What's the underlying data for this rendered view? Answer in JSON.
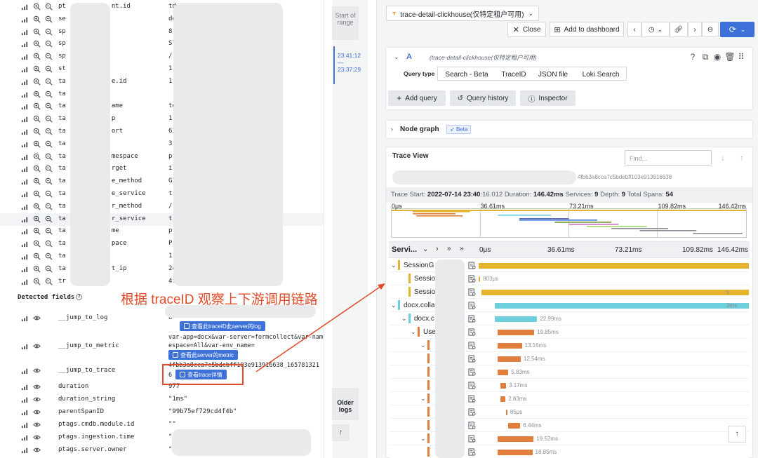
{
  "left_panel": {
    "fields": [
      {
        "k": "pt            nt.id",
        "v": "td"
      },
      {
        "k": "se",
        "v": "de"
      },
      {
        "k": "sp",
        "v": "8("
      },
      {
        "k": "sp",
        "v": "Sl"
      },
      {
        "k": "sp",
        "v": "/                     GET"
      },
      {
        "k": "st",
        "v": "1"
      },
      {
        "k": "ta            e.id",
        "v": "1"
      },
      {
        "k": "ta",
        "v": ""
      },
      {
        "k": "ta            ame",
        "v": "to                    -4"
      },
      {
        "k": "ta            p",
        "v": "1("
      },
      {
        "k": "ta            ort",
        "v": "63"
      },
      {
        "k": "ta",
        "v": "3("
      },
      {
        "k": "ta            mespace",
        "v": "p"
      },
      {
        "k": "ta            rget",
        "v": "i("
      },
      {
        "k": "ta            e_method",
        "v": "GI"
      },
      {
        "k": "ta            e_service",
        "v": "t"
      },
      {
        "k": "ta            r_method",
        "v": "/("
      },
      {
        "k": "ta            r_service",
        "v": "t                     Service"
      },
      {
        "k": "ta            me",
        "v": "p"
      },
      {
        "k": "ta            pace",
        "v": "P"
      },
      {
        "k": "ta",
        "v": "1-"
      },
      {
        "k": "ta            t_ip",
        "v": "24                    :1:a1df"
      },
      {
        "k": "tr",
        "v": "4f"
      }
    ],
    "detected_title": "Detected fields",
    "detected": [
      {
        "k": "__jump_to_log",
        "v": "8'"
      },
      {
        "k": "__jump_to_metric",
        "v": ""
      },
      {
        "k": "__jump_to_trace",
        "v": ""
      },
      {
        "k": "duration",
        "v": "977"
      },
      {
        "k": "duration_string",
        "v": "\"1ms\""
      },
      {
        "k": "parentSpanID",
        "v": "\"99b75ef729cd4f4b\""
      },
      {
        "k": "ptags.cmdb.module.id",
        "v": "\"\""
      },
      {
        "k": "ptags.ingestion.time",
        "v": "\""
      },
      {
        "k": "ptags.server.owner",
        "v": "\""
      }
    ],
    "metric_lines": [
      "var-app=docx&var-server=formcollect&var-nam",
      "espace=All&var-env_name="
    ],
    "trace_lines": [
      "4fbb3a8cca7c5bdebff103e913916638_165781321",
      "6"
    ],
    "log_button": "查看此traceID此server的log",
    "metric_button": "查看此server的metric",
    "trace_button": "查看trace详情",
    "annotation": "根据 traceID 观察上下游调用链路"
  },
  "mid_strip": {
    "start_range": "Start of range",
    "range_from": "23:41:12",
    "range_sep": "—",
    "range_to": "23:37:29",
    "older_logs": "Older logs",
    "up_label": "↑"
  },
  "right_panel": {
    "datasource": "trace-detail-clickhouse(仅特定租户可用)",
    "close": "Close",
    "add_dashboard": "Add to dashboard",
    "query_letter": "A",
    "query_ds": "(trace-detail-clickhouse(仅特定租户可用)",
    "query_type_label": "Query type",
    "query_tabs": [
      "Search - Beta",
      "TraceID",
      "JSON file",
      "Loki Search"
    ],
    "add_query": "Add query",
    "query_history": "Query history",
    "inspector": "Inspector",
    "node_graph": "Node graph",
    "beta": "Beta",
    "trace_view": "Trace View",
    "find_placeholder": "Find...",
    "trace_id": "4fbb3a8cca7c5bdebff103e913916638",
    "meta": {
      "start_label": "Trace Start:",
      "start": "2022-07-14 23:40",
      "start_ms": ":16.012",
      "duration_label": "Duration:",
      "duration": "146.42ms",
      "services_label": "Services:",
      "services": "9",
      "depth_label": "Depth:",
      "depth": "9",
      "spans_label": "Total Spans:",
      "spans": "54"
    },
    "minimap_ticks": [
      "0μs",
      "36.61ms",
      "73.21ms",
      "109.82ms",
      "146.42ms"
    ],
    "header_label": "Servi...",
    "header_ticks": [
      "0μs",
      "36.61ms",
      "73.21ms",
      "109.82ms",
      "146.42ms"
    ],
    "spans": [
      {
        "name": "SessionG",
        "color": "#e4b32e",
        "start": 0.0,
        "end": 1.0,
        "label": ""
      },
      {
        "name": "Sessio",
        "color": "#e4b32e",
        "start": 0.0,
        "end": 0.0055,
        "label": "803μs"
      },
      {
        "name": "Sessio",
        "color": "#e4b32e",
        "start": 0.01,
        "end": 1.0,
        "label": "s"
      },
      {
        "name": "docx.colla",
        "color": "#6ccfdb",
        "start": 0.06,
        "end": 1.0,
        "label": "3ms"
      },
      {
        "name": "docx.c",
        "color": "#6ccfdb",
        "start": 0.06,
        "end": 0.2163,
        "label": "22.99ms"
      },
      {
        "name": "Use",
        "color": "#e07e3c",
        "start": 0.07,
        "end": 0.2056,
        "label": "19.85ms"
      },
      {
        "name": "",
        "color": "#e07e3c",
        "start": 0.07,
        "end": 0.1599,
        "label": "13.16ms"
      },
      {
        "name": "",
        "color": "#e07e3c",
        "start": 0.07,
        "end": 0.1556,
        "label": "12.54ms"
      },
      {
        "name": "",
        "color": "#e07e3c",
        "start": 0.07,
        "end": 0.1098,
        "label": "5.83ms"
      },
      {
        "name": "",
        "color": "#e07e3c",
        "start": 0.08,
        "end": 0.1016,
        "label": "3.17ms"
      },
      {
        "name": "",
        "color": "#e07e3c",
        "start": 0.08,
        "end": 0.0993,
        "label": "2.83ms"
      },
      {
        "name": "",
        "color": "#e07e3c",
        "start": 0.1,
        "end": 0.1058,
        "label": "85μs"
      },
      {
        "name": "",
        "color": "#e07e3c",
        "start": 0.11,
        "end": 0.154,
        "label": "6.44ms"
      },
      {
        "name": "",
        "color": "#e07e3c",
        "start": 0.07,
        "end": 0.2033,
        "label": "19.52ms"
      },
      {
        "name": "",
        "color": "#e07e3c",
        "start": 0.07,
        "end": 0.1988,
        "label": "18.85ms"
      }
    ],
    "scroll_up": "↑"
  },
  "colors": {
    "accent": "#3d71d9",
    "annotation": "#e04b2a",
    "span_yellow": "#e4b32e",
    "span_cyan": "#6ccfdb",
    "span_orange": "#e07e3c"
  }
}
